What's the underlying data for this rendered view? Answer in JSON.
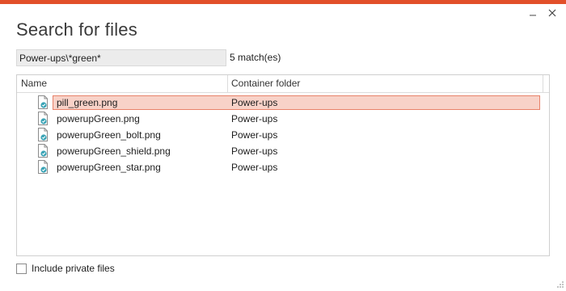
{
  "colors": {
    "accent": "#e2502a",
    "selection_fill": "#f8d2c8",
    "selection_border": "#e8826a",
    "file_icon": "#3aa3b5"
  },
  "window": {
    "title": "Search for files",
    "minimize_glyph": "–",
    "close_glyph": "✕"
  },
  "search": {
    "value": "Power-ups\\*green*",
    "result_count": "5 match(es)"
  },
  "table": {
    "columns": [
      "Name",
      "Container folder"
    ],
    "rows": [
      {
        "name": "pill_green.png",
        "folder": "Power-ups",
        "selected": true,
        "icon": "image-file-icon"
      },
      {
        "name": "powerupGreen.png",
        "folder": "Power-ups",
        "selected": false,
        "icon": "image-file-icon"
      },
      {
        "name": "powerupGreen_bolt.png",
        "folder": "Power-ups",
        "selected": false,
        "icon": "image-file-icon"
      },
      {
        "name": "powerupGreen_shield.png",
        "folder": "Power-ups",
        "selected": false,
        "icon": "image-file-icon"
      },
      {
        "name": "powerupGreen_star.png",
        "folder": "Power-ups",
        "selected": false,
        "icon": "image-file-icon"
      }
    ]
  },
  "footer": {
    "include_private_label": "Include private files",
    "include_private_checked": false
  }
}
